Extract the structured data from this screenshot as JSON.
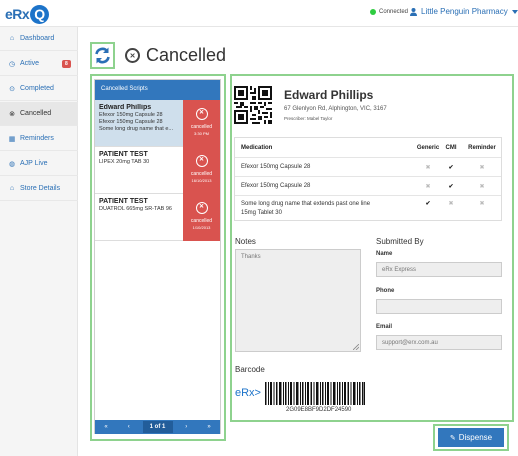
{
  "header": {
    "status": "Connected",
    "pharmacy": "Little Penguin Pharmacy",
    "logo_text": "eRx"
  },
  "sidebar": {
    "items": [
      {
        "label": "Dashboard",
        "icon": "home-icon"
      },
      {
        "label": "Active",
        "icon": "clock-icon",
        "badge": "8"
      },
      {
        "label": "Completed",
        "icon": "check-circle-icon"
      },
      {
        "label": "Cancelled",
        "icon": "cancel-circle-icon",
        "active": true
      },
      {
        "label": "Reminders",
        "icon": "calendar-icon"
      },
      {
        "label": "AJP Live",
        "icon": "globe-icon"
      },
      {
        "label": "Store Details",
        "icon": "home-icon"
      }
    ]
  },
  "page": {
    "title": "Cancelled"
  },
  "list": {
    "header": "Cancelled Scripts",
    "scripts": [
      {
        "name": "Edward Phillips",
        "lines": [
          "Efexor 150mg Capsule 28",
          "Efexor 150mg Capsule 28",
          "Some long drug name that e..."
        ],
        "status": "cancelled",
        "time": "3:30 PM"
      },
      {
        "name": "PATIENT TEST",
        "lines": [
          "LIPEX 20mg TAB 30"
        ],
        "status": "cancelled",
        "time": "16/10/2013"
      },
      {
        "name": "PATIENT TEST",
        "lines": [
          "DUATROL 665mg SR-TAB 96"
        ],
        "status": "cancelled",
        "time": "1/10/2013"
      }
    ],
    "pager": {
      "first": "«",
      "prev": "‹",
      "current": "1 of 1",
      "next": "›",
      "last": "»"
    }
  },
  "detail": {
    "patient_name": "Edward Phillips",
    "address": "67 Glenlyon Rd, Alphington, VIC, 3167",
    "prescriber": "Prescriber: Mabel Taylor",
    "table": {
      "headers": [
        "Medication",
        "Generic",
        "CMI",
        "Reminder"
      ],
      "rows": [
        {
          "medication": "Efexor 150mg Capsule 28",
          "generic": "✖",
          "cmi": "✔",
          "reminder": "✖"
        },
        {
          "medication": "Efexor 150mg Capsule 28",
          "generic": "✖",
          "cmi": "✔",
          "reminder": "✖"
        },
        {
          "medication_line1": "Some long drug name that extends past one line",
          "medication_line2": "15mg Tablet 30",
          "generic": "✔",
          "cmi": "✖",
          "reminder": "✖"
        }
      ]
    },
    "notes_label": "Notes",
    "notes_value": "Thanks",
    "submitted_by": {
      "title": "Submitted By",
      "name_label": "Name",
      "name_value": "eRx Express",
      "phone_label": "Phone",
      "phone_value": "",
      "email_label": "Email",
      "email_value": "support@erx.com.au"
    },
    "barcode_label": "Barcode",
    "barcode_logo": "eRx>",
    "barcode_value": "2G09E8BF9D2DF24590"
  },
  "actions": {
    "dispense": "Dispense"
  },
  "colors": {
    "brand_blue": "#3277bd",
    "cancel_red": "#d9534f",
    "highlight_green": "#8ed28e",
    "connected_green": "#2ecc40"
  }
}
